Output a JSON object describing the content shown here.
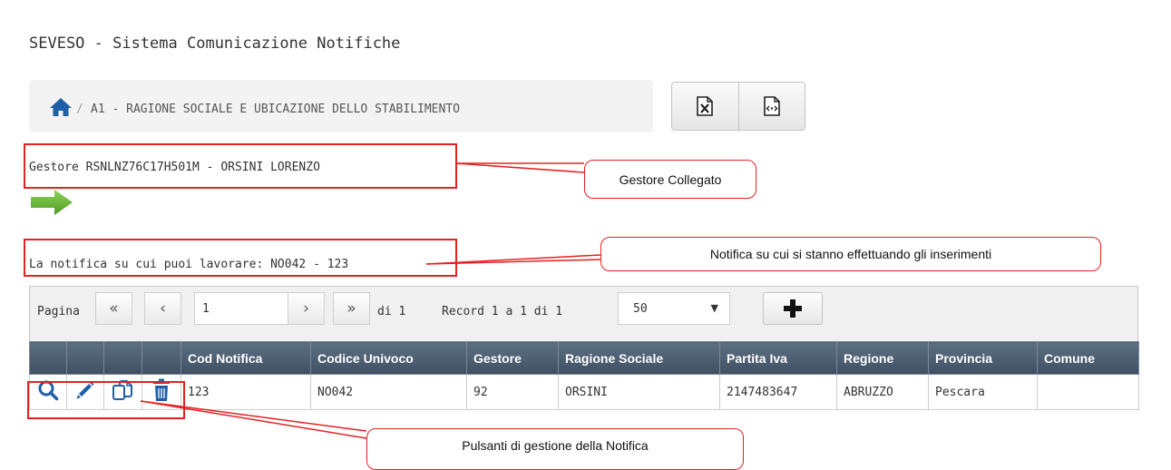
{
  "page": {
    "title": "SEVESO - Sistema Comunicazione Notifiche"
  },
  "breadcrumb": {
    "home_icon": "home-icon",
    "separator": "/",
    "current": "A1 - RAGIONE SOCIALE E UBICAZIONE DELLO STABILIMENTO"
  },
  "export": [
    {
      "icon": "excel-export-icon"
    },
    {
      "icon": "xml-export-icon"
    }
  ],
  "gestore": {
    "text": "Gestore RSNLNZ76C17H501M - ORSINI LORENZO"
  },
  "navigation": {
    "icon": "arrow-right-icon",
    "color": "#6db33f"
  },
  "notifica": {
    "text": "La notifica su cui puoi lavorare: NO042 - 123"
  },
  "pager": {
    "label": "Pagina",
    "first_icon": "«",
    "prev_icon": "‹",
    "page_value": "1",
    "next_icon": "›",
    "last_icon": "»",
    "of_text": "di 1",
    "records_text": "Record 1 a 1 di 1",
    "page_size": "50",
    "add_icon": "plus-icon"
  },
  "table": {
    "columns": [
      "",
      "",
      "",
      "",
      "Cod Notifica",
      "Codice Univoco",
      "Gestore",
      "Ragione Sociale",
      "Partita Iva",
      "Regione",
      "Provincia",
      "Comune"
    ],
    "rows": [
      {
        "actions": [
          "search-icon",
          "edit-icon",
          "copy-icon",
          "trash-icon"
        ],
        "cod_notifica": "123",
        "codice_univoco": "NO042",
        "gestore": "92",
        "ragione_sociale": "ORSINI",
        "partita_iva": "2147483647",
        "regione": "ABRUZZO",
        "provincia": "Pescara",
        "comune": ""
      }
    ]
  },
  "callouts": [
    {
      "text": "Gestore Collegato"
    },
    {
      "text": "Notifica su cui si stanno effettuando gli inserimenti"
    },
    {
      "text": "Pulsanti di gestione della Notifica"
    }
  ],
  "colors": {
    "accent_blue": "#1f5fa8",
    "header_bg": "#4a5b6e",
    "callout_red": "#e52121"
  }
}
